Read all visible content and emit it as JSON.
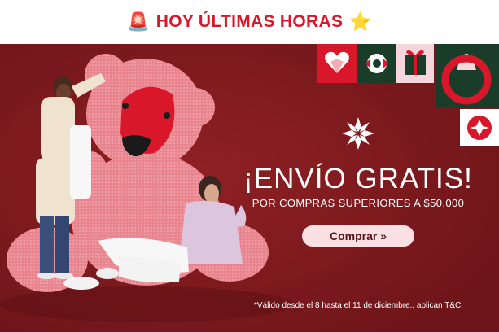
{
  "topbar": {
    "siren_icon": "🚨",
    "title": "HOY ÚLTIMAS HORAS",
    "star_icon": "⭐"
  },
  "hero": {
    "headline": "¡ENVÍO GRATIS!",
    "subline": "POR COMPRAS SUPERIORES A $50.000",
    "cta_label": "Comprar »",
    "legal": "*Válido desde el 8 hasta el 11 de diciembre., aplican T&C."
  },
  "colors": {
    "accent_red": "#d8182a",
    "hero_bg": "#7e1a1e",
    "tile_green": "#1a3d2a",
    "tile_pink": "#f6d6dc",
    "button_bg": "#fbe0e3"
  }
}
